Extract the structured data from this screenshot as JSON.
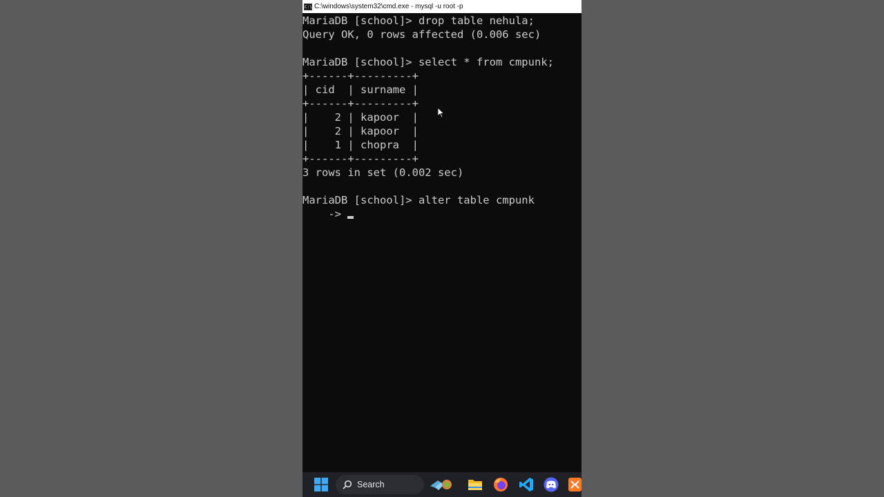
{
  "window": {
    "title": "C:\\windows\\system32\\cmd.exe - mysql  -u root -p"
  },
  "terminal": {
    "lines": [
      "MariaDB [school]> drop table nehula;",
      "Query OK, 0 rows affected (0.006 sec)",
      "",
      "MariaDB [school]> select * from cmpunk;",
      "+------+---------+",
      "| cid  | surname |",
      "+------+---------+",
      "|    2 | kapoor  |",
      "|    2 | kapoor  |",
      "|    1 | chopra  |",
      "+------+---------+",
      "3 rows in set (0.002 sec)",
      "",
      "MariaDB [school]> alter table cmpunk",
      "    -> "
    ],
    "table": {
      "columns": [
        "cid",
        "surname"
      ],
      "rows": [
        [
          "2",
          "kapoor"
        ],
        [
          "2",
          "kapoor"
        ],
        [
          "1",
          "chopra"
        ]
      ]
    }
  },
  "taskbar": {
    "search_label": "Search",
    "icons": [
      "windows-start-icon",
      "search-icon",
      "widgets-icon",
      "file-explorer-icon",
      "firefox-icon",
      "vscode-icon",
      "discord-icon",
      "xampp-icon"
    ]
  },
  "colors": {
    "background": "#5b5b5b",
    "terminal_bg": "#0c0c0c",
    "terminal_fg": "#cccccc",
    "taskbar_bg": "#1f2126"
  }
}
